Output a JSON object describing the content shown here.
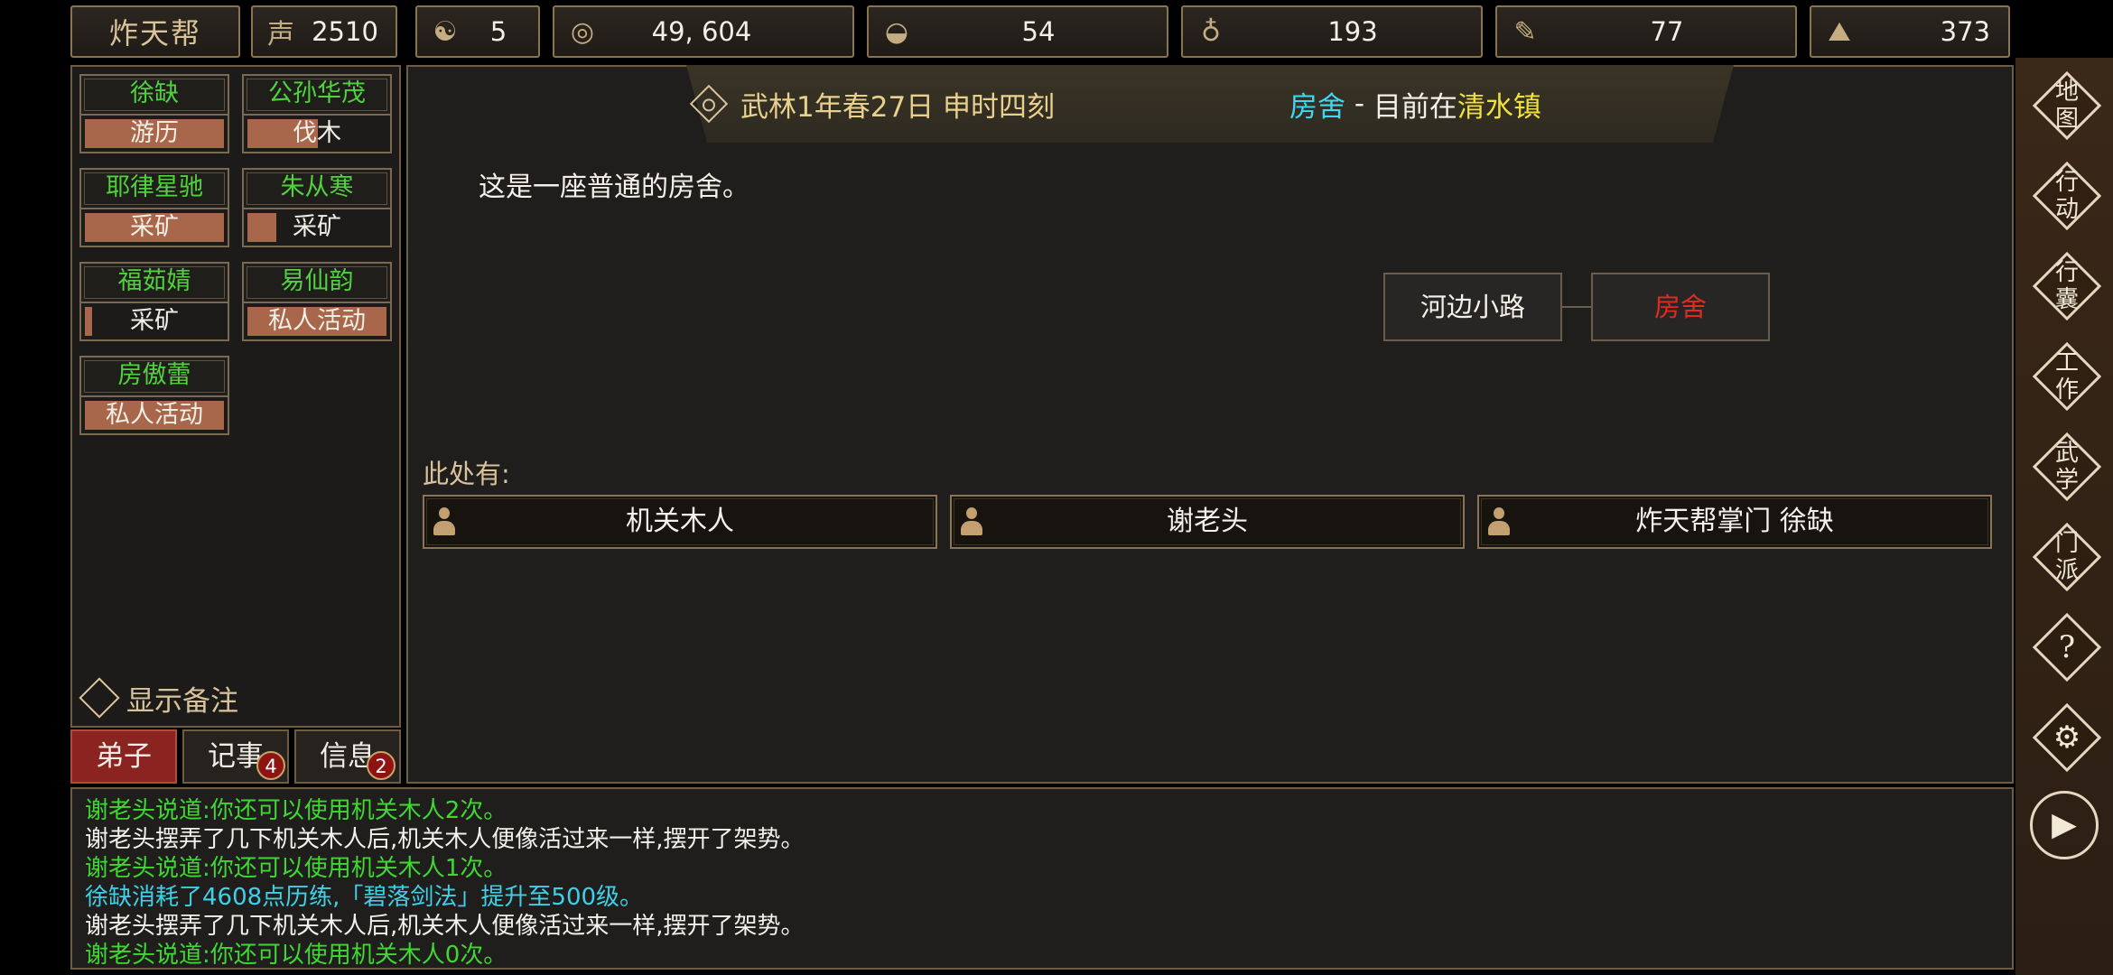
{
  "topbar": {
    "gang_name": "炸天帮",
    "resources": [
      {
        "icon": "prestige-icon",
        "glyph": "声",
        "value": "2510"
      },
      {
        "icon": "yin-yang-icon",
        "glyph": "☯",
        "value": "5"
      },
      {
        "icon": "coin-icon",
        "glyph": "◎",
        "value": "49, 604"
      },
      {
        "icon": "food-bowl-icon",
        "glyph": "◒",
        "value": "54"
      },
      {
        "icon": "gourd-icon",
        "glyph": "♁",
        "value": "193"
      },
      {
        "icon": "scroll-icon",
        "glyph": "✎",
        "value": "77"
      },
      {
        "icon": "ore-icon",
        "glyph": "⛰",
        "value": "373"
      }
    ]
  },
  "disciples": [
    {
      "name": "徐缺",
      "job": "游历",
      "progress": 1.0
    },
    {
      "name": "公孙华茂",
      "job": "伐木",
      "progress": 0.5
    },
    {
      "name": "耶律星驰",
      "job": "采矿",
      "progress": 1.0
    },
    {
      "name": "朱从寒",
      "job": "采矿",
      "progress": 0.13
    },
    {
      "name": "福茹婧",
      "job": "采矿",
      "progress": 0.04
    },
    {
      "name": "易仙韵",
      "job": "私人活动",
      "progress": 1.0
    },
    {
      "name": "房傲蕾",
      "job": "私人活动",
      "progress": 1.0
    }
  ],
  "notes_label": "显示备注",
  "tabs": [
    {
      "label": "弟子",
      "badge": ""
    },
    {
      "label": "记事",
      "badge": "4"
    },
    {
      "label": "信息",
      "badge": "2"
    }
  ],
  "header": {
    "datetime": "武林1年春27日 申时四刻",
    "location": "房舍",
    "separator": " - ",
    "current_prefix": "目前在",
    "town": "清水镇"
  },
  "description": "这是一座普通的房舍。",
  "map": {
    "left_node": "河边小路",
    "current_node": "房舍"
  },
  "here_label": "此处有:",
  "npcs": [
    "机关木人",
    "谢老头",
    "炸天帮掌门 徐缺"
  ],
  "menu": [
    {
      "id": "map",
      "label": "地图"
    },
    {
      "id": "action",
      "label": "行动"
    },
    {
      "id": "bag",
      "label": "行囊"
    },
    {
      "id": "work",
      "label": "工作"
    },
    {
      "id": "martial",
      "label": "武学"
    },
    {
      "id": "sect",
      "label": "门派"
    }
  ],
  "round_buttons": {
    "help": "?",
    "settings": "⚙",
    "play": "▶"
  },
  "log": [
    {
      "text": "谢老头说道:你还可以使用机关木人2次。",
      "color": "#3fd833"
    },
    {
      "text": "谢老头摆弄了几下机关木人后,机关木人便像活过来一样,摆开了架势。",
      "color": "#f2f0ea"
    },
    {
      "text": "谢老头说道:你还可以使用机关木人1次。",
      "color": "#3fd833"
    },
    {
      "text": "徐缺消耗了4608点历练,「碧落剑法」提升至500级。",
      "color": "#3fd0e8"
    },
    {
      "text": "谢老头摆弄了几下机关木人后,机关木人便像活过来一样,摆开了架势。",
      "color": "#f2f0ea"
    },
    {
      "text": "谢老头说道:你还可以使用机关木人0次。",
      "color": "#3fd833"
    }
  ],
  "colors": {
    "name_green": "#4fd23e",
    "location_cyan": "#3fd8f0",
    "town_yellow": "#f0e23a",
    "current_node_red": "#e02a22",
    "accent_gold": "#d9c39b"
  }
}
